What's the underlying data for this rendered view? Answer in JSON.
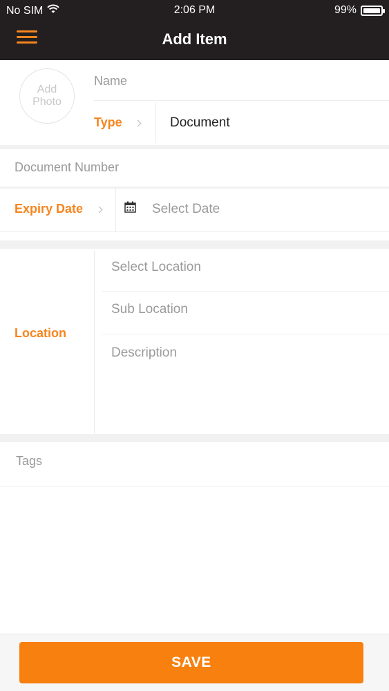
{
  "status_bar": {
    "carrier": "No SIM",
    "time": "2:06 PM",
    "battery": "99%",
    "battery_level": 0.99
  },
  "navbar": {
    "title": "Add Item",
    "menu_icon": "hamburger-menu-icon"
  },
  "form": {
    "photo_label": "Add Photo",
    "name_placeholder": "Name",
    "type_label": "Type",
    "type_value": "Document",
    "document_number_placeholder": "Document Number",
    "expiry_label": "Expiry Date",
    "expiry_placeholder": "Select Date",
    "calendar_icon": "calendar-icon",
    "location_label": "Location",
    "select_location_placeholder": "Select Location",
    "sub_location_placeholder": "Sub Location",
    "description_placeholder": "Description",
    "tags_placeholder": "Tags"
  },
  "footer": {
    "save_label": "SAVE"
  },
  "colors": {
    "accent": "#f7851e",
    "header_bg": "#231f20",
    "save_bg": "#f7800f"
  }
}
